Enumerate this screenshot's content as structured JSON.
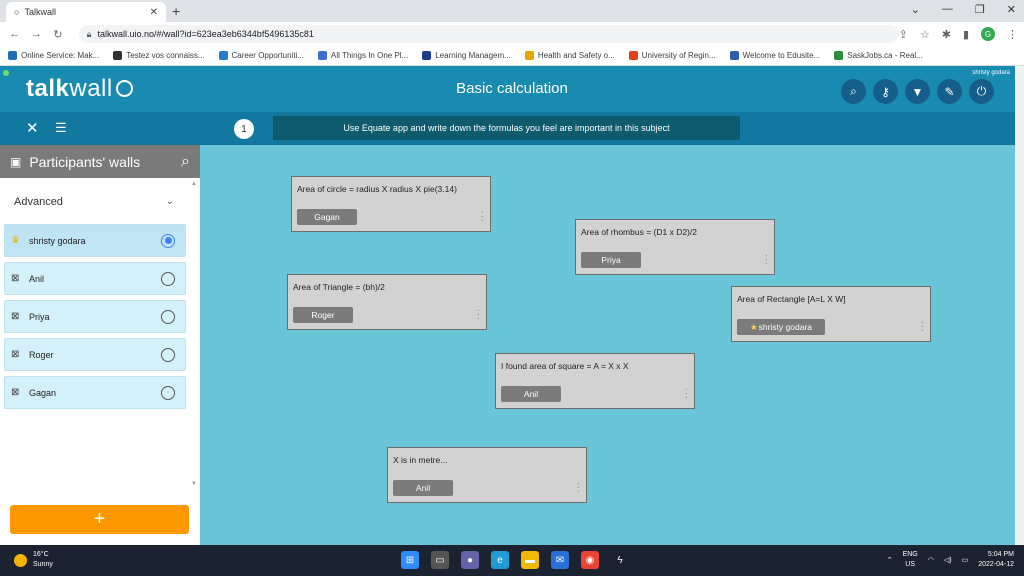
{
  "browser": {
    "tab_title": "Talkwall",
    "url": "talkwall.uio.no/#/wall?id=623ea3eb6344bf5496135c81",
    "bookmarks": [
      {
        "label": "Online Service: Mak...",
        "color": "#1f6fb2"
      },
      {
        "label": "Testez vos connaiss...",
        "color": "#333333"
      },
      {
        "label": "Career Opportuniti...",
        "color": "#2a7bd4"
      },
      {
        "label": "All Things In One Pl...",
        "color": "#3b6fd1"
      },
      {
        "label": "Learning Managem...",
        "color": "#1d3c8c"
      },
      {
        "label": "Health and Safety o...",
        "color": "#e8a400"
      },
      {
        "label": "University of Regin...",
        "color": "#e0421b"
      },
      {
        "label": "Welcome to Edusite...",
        "color": "#2c5fae"
      },
      {
        "label": "SaskJobs.ca - Real...",
        "color": "#2b8f3a"
      }
    ],
    "profile_initial": "G"
  },
  "header": {
    "logo_bold": "talk",
    "logo_light": "wall",
    "title": "Basic calculation",
    "user": "shristy godara",
    "icons": [
      "zoom-icon",
      "key-icon",
      "filter-icon",
      "edit-icon",
      "logout-icon"
    ]
  },
  "subbar": {
    "count": "1",
    "task": "Use Equate app and write down the formulas you feel are important in this subject"
  },
  "sidebar": {
    "title": "Participants' walls",
    "filter": "Advanced",
    "participants": [
      {
        "name": "shristy godara",
        "selected": true
      },
      {
        "name": "Anil",
        "selected": false
      },
      {
        "name": "Priya",
        "selected": false
      },
      {
        "name": "Roger",
        "selected": false
      },
      {
        "name": "Gagan",
        "selected": false
      }
    ],
    "add_label": "+"
  },
  "wall": {
    "notes": [
      {
        "text": "Area of circle = radius X radius X pie(3.14)",
        "author": "Gagan",
        "starred": false
      },
      {
        "text": "Area of rhombus = (D1 x D2)/2",
        "author": "Priya",
        "starred": false
      },
      {
        "text": "Area of Triangle = (bh)/2",
        "author": "Roger",
        "starred": false
      },
      {
        "text": "Area of Rectangle [A=L X W]",
        "author": "shristy godara",
        "starred": true
      },
      {
        "text": "I found area of square = A = X x X",
        "author": "Anil",
        "starred": false
      },
      {
        "text": "X is in metre...",
        "author": "Anil",
        "starred": false
      }
    ]
  },
  "taskbar": {
    "temp": "16°C",
    "weather": "Sunny",
    "lang_top": "ENG",
    "lang_bottom": "US",
    "time": "5:04 PM",
    "date": "2022-04-12"
  },
  "colors": {
    "header": "#1a8bb0",
    "subbar": "#1378a0",
    "wall": "#6ac5d9",
    "add_button": "#ff9800"
  }
}
